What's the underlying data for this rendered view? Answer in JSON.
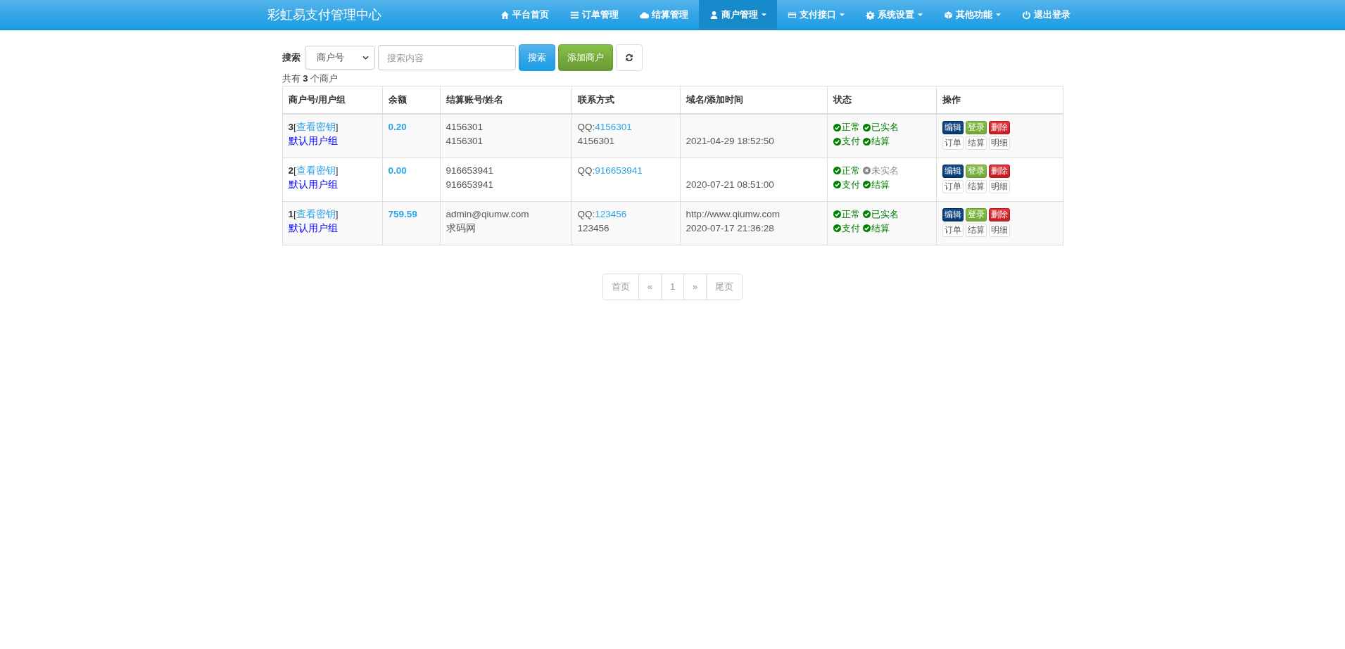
{
  "navbar": {
    "brand": "彩虹易支付管理中心",
    "items": [
      {
        "label": "平台首页",
        "selected": false,
        "dropdown": false
      },
      {
        "label": "订单管理",
        "selected": false,
        "dropdown": false
      },
      {
        "label": "结算管理",
        "selected": false,
        "dropdown": false
      },
      {
        "label": "商户管理",
        "selected": true,
        "dropdown": true
      },
      {
        "label": "支付接口",
        "selected": false,
        "dropdown": true
      },
      {
        "label": "系统设置",
        "selected": false,
        "dropdown": true
      },
      {
        "label": "其他功能",
        "selected": false,
        "dropdown": true
      },
      {
        "label": "退出登录",
        "selected": false,
        "dropdown": false
      }
    ]
  },
  "search": {
    "label": "搜索",
    "select_value": "商户号",
    "placeholder": "搜索内容",
    "search_button": "搜索",
    "add_button": "添加商户"
  },
  "count": {
    "prefix": "共有",
    "number": "3",
    "suffix": "个商户"
  },
  "table": {
    "columns": [
      "商户号/用户组",
      "余额",
      "结算账号/姓名",
      "联系方式",
      "域名/添加时间",
      "状态",
      "操作"
    ],
    "rows": [
      {
        "id": "3",
        "bracket_open": "[",
        "key_link": "查看密钥",
        "bracket_close": "]",
        "group": "默认用户组",
        "balance": "0.20",
        "account": "4156301",
        "name": "4156301",
        "contact_prefix": "QQ:",
        "qq": "4156301",
        "contact": "4156301",
        "domain": "",
        "time": "2021-04-29 18:52:50",
        "statuses": [
          {
            "label": "正常",
            "on": true
          },
          {
            "label": "已实名",
            "on": true
          },
          {
            "label": "支付",
            "on": true
          },
          {
            "label": "结算",
            "on": true
          }
        ],
        "actions": [
          {
            "label": "编辑",
            "kind": "edit"
          },
          {
            "label": "登录",
            "kind": "login"
          },
          {
            "label": "删除",
            "kind": "delete"
          },
          {
            "label": "订单",
            "kind": "plain"
          },
          {
            "label": "结算",
            "kind": "plain"
          },
          {
            "label": "明细",
            "kind": "plain"
          }
        ]
      },
      {
        "id": "2",
        "bracket_open": "[",
        "key_link": "查看密钥",
        "bracket_close": "]",
        "group": "默认用户组",
        "balance": "0.00",
        "account": "916653941",
        "name": "916653941",
        "contact_prefix": "QQ:",
        "qq": "916653941",
        "contact": "",
        "domain": "",
        "time": "2020-07-21 08:51:00",
        "statuses": [
          {
            "label": "正常",
            "on": true
          },
          {
            "label": "未实名",
            "on": false
          },
          {
            "label": "支付",
            "on": true
          },
          {
            "label": "结算",
            "on": true
          }
        ],
        "actions": [
          {
            "label": "编辑",
            "kind": "edit"
          },
          {
            "label": "登录",
            "kind": "login"
          },
          {
            "label": "删除",
            "kind": "delete"
          },
          {
            "label": "订单",
            "kind": "plain"
          },
          {
            "label": "结算",
            "kind": "plain"
          },
          {
            "label": "明细",
            "kind": "plain"
          }
        ]
      },
      {
        "id": "1",
        "bracket_open": "[",
        "key_link": "查看密钥",
        "bracket_close": "]",
        "group": "默认用户组",
        "balance": "759.59",
        "account": "admin@qiumw.com",
        "name": "求码网",
        "contact_prefix": "QQ:",
        "qq": "123456",
        "contact": "123456",
        "domain": "http://www.qiumw.com",
        "time": "2020-07-17 21:36:28",
        "statuses": [
          {
            "label": "正常",
            "on": true
          },
          {
            "label": "已实名",
            "on": true
          },
          {
            "label": "支付",
            "on": true
          },
          {
            "label": "结算",
            "on": true
          }
        ],
        "actions": [
          {
            "label": "编辑",
            "kind": "edit"
          },
          {
            "label": "登录",
            "kind": "login"
          },
          {
            "label": "删除",
            "kind": "delete"
          },
          {
            "label": "订单",
            "kind": "plain"
          },
          {
            "label": "结算",
            "kind": "plain"
          },
          {
            "label": "明细",
            "kind": "plain"
          }
        ]
      }
    ]
  },
  "pagination": [
    {
      "label": "首页",
      "selected": false
    },
    {
      "label": "«",
      "selected": false
    },
    {
      "label": "1",
      "selected": false
    },
    {
      "label": "»",
      "selected": false
    },
    {
      "label": "尾页",
      "selected": false
    }
  ]
}
